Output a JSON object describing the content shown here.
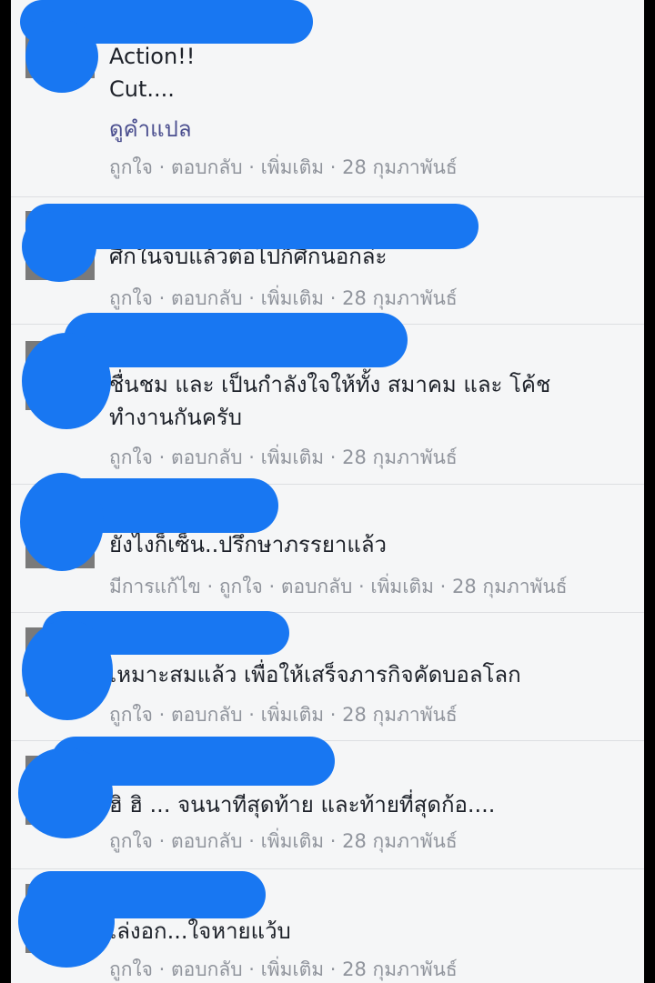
{
  "ui": {
    "sep": " · ",
    "colors": {
      "panel_bg": "#f5f6f7",
      "text": "#1d2129",
      "meta": "#90949c",
      "link": "#4b4f8f",
      "redaction": "#1877f2"
    }
  },
  "comments": [
    {
      "lines": [
        "Action!!",
        "Cut...."
      ],
      "translate": "ดูคำแปล",
      "actions": {
        "like": "ถูกใจ",
        "reply": "ตอบกลับ",
        "more": "เพิ่มเติม",
        "time": "28 กุมภาพันธ์"
      }
    },
    {
      "lines": [
        "ศึกในจบแล้วต่อไปก็ศึกนอกล่ะ"
      ],
      "actions": {
        "like": "ถูกใจ",
        "reply": "ตอบกลับ",
        "more": "เพิ่มเติม",
        "time": "28 กุมภาพันธ์"
      }
    },
    {
      "lines": [
        "ชื่นชม และ เป็นกำลังใจให้ทั้ง สมาคม และ โค้ช",
        "ทำงานกันครับ"
      ],
      "actions": {
        "like": "ถูกใจ",
        "reply": "ตอบกลับ",
        "more": "เพิ่มเติม",
        "time": "28 กุมภาพันธ์"
      }
    },
    {
      "lines": [
        "ยังไงก็เซ็น..ปรึกษาภรรยาแล้ว"
      ],
      "actions": {
        "edited": "มีการแก้ไข",
        "like": "ถูกใจ",
        "reply": "ตอบกลับ",
        "more": "เพิ่มเติม",
        "time": "28 กุมภาพันธ์"
      }
    },
    {
      "lines": [
        "เหมาะสมแล้ว เพื่อให้เสร็จภารกิจคัดบอลโลก"
      ],
      "actions": {
        "like": "ถูกใจ",
        "reply": "ตอบกลับ",
        "more": "เพิ่มเติม",
        "time": "28 กุมภาพันธ์"
      }
    },
    {
      "lines": [
        "ฮิ ฮิ ... จนนาทีสุดท้าย และท้ายที่สุดก้อ...."
      ],
      "actions": {
        "like": "ถูกใจ",
        "reply": "ตอบกลับ",
        "more": "เพิ่มเติม",
        "time": "28 กุมภาพันธ์"
      }
    },
    {
      "lines": [
        "เล่งอก...ใจหายแว้บ"
      ],
      "actions": {
        "like": "ถูกใจ",
        "reply": "ตอบกลับ",
        "more": "เพิ่มเติม",
        "time": "28 กุมภาพันธ์"
      }
    }
  ]
}
